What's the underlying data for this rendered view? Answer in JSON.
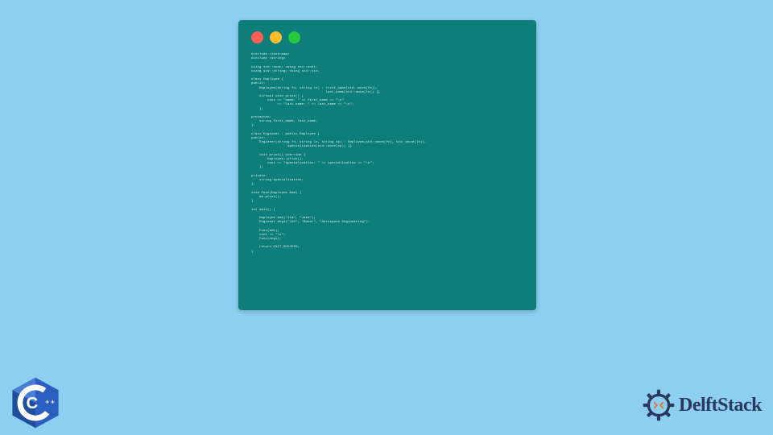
{
  "window": {
    "dots": [
      "red",
      "yellow",
      "green"
    ]
  },
  "code_lines": [
    "#include <iostream>",
    "#include <string>",
    "",
    "using std::cout; using std::endl;",
    "using std::string; using std::cin;",
    "",
    "class Employee {",
    "public:",
    "    Employee(string fn, string ln) : first_name(std::move(fn)),",
    "                                     last_name(std::move(ln)) {}",
    "    virtual void print() {",
    "        cout << \"name: \" << first_name << \"\\n\"",
    "             << \"last name: \" << last_name << \"\\n\";",
    "    };",
    "",
    "protected:",
    "    string first_name, last_name;",
    "};",
    "",
    "class Engineer : public Employee {",
    "public:",
    "    Engineer(string fn, string ln, string sp) : Employee(std::move(fn), std::move(ln)),",
    "                  specialization(std::move(sp)) {}",
    "",
    "    void print() override {",
    "        Employee::print();",
    "        cout << \"specialization: \" << specialization << \"\\n\";",
    "    };",
    "",
    "private:",
    "    string specialization;",
    "};",
    "",
    "void Func(Employee &em) {",
    "    em.print();",
    "}",
    "",
    "int main() {",
    "",
    "    Employee em1(\"Jim\", \"Jake\");",
    "    Engineer eng1(\"Jin\", \"Baker\", \"Aerospace Engineering\");",
    "",
    "    Func(em1);",
    "    cout << \"\\n\";",
    "    Func(eng1);",
    "",
    "    return EXIT_SUCCESS;",
    "}"
  ],
  "logos": {
    "cpp_label": "C++",
    "delft_label": "DelftStack"
  },
  "colors": {
    "bg": "#8ccff0",
    "window_bg": "#0d7e7a",
    "code_text": "#d8f0ee",
    "cpp_blue": "#1f4e9c",
    "delft_navy": "#2a3a5e",
    "delft_orange": "#e67a3a"
  }
}
